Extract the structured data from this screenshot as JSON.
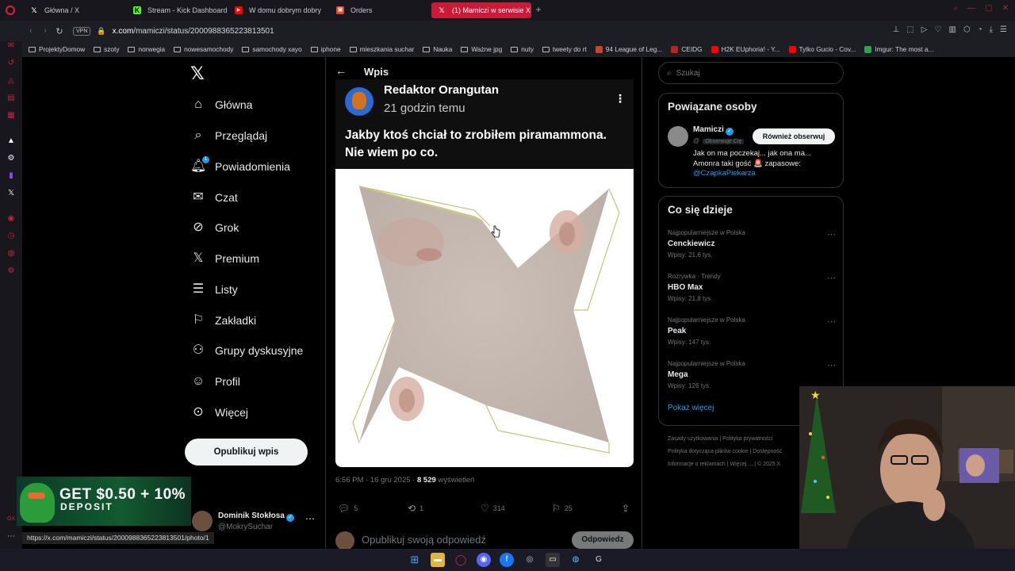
{
  "tabs": [
    {
      "title": "Główna / X",
      "favicon": "x-icon"
    },
    {
      "title": "Stream - Kick Dashboard",
      "favicon": "kick-icon"
    },
    {
      "title": "W domu dobrym dobry s",
      "favicon": "youtube-icon"
    },
    {
      "title": "Orders",
      "favicon": "orders-icon"
    },
    {
      "title": "(1) Mamiczi w serwisie X:",
      "favicon": "x-icon",
      "active": true
    }
  ],
  "address": {
    "vpn": "VPN",
    "host": "x.com",
    "path": "/mamiczi/status/2000988365223813501"
  },
  "bookmarks": [
    "ProjektyDomow",
    "szoty",
    "norwegia",
    "nowesamochody",
    "samochody xayo",
    "iphone",
    "mieszkania suchar",
    "Nauka",
    "Ważne jpg",
    "nuty",
    "tweety do rt",
    "94 League of Leg...",
    "CEIDG",
    "H2K EUphoria! - Y...",
    "Tylko Gucio - Cov...",
    "Imgur: The most a..."
  ],
  "nav": [
    {
      "label": "Główna",
      "icon": "home-icon"
    },
    {
      "label": "Przeglądaj",
      "icon": "search-icon"
    },
    {
      "label": "Powiadomienia",
      "icon": "bell-icon",
      "badge": "1"
    },
    {
      "label": "Czat",
      "icon": "mail-icon"
    },
    {
      "label": "Grok",
      "icon": "grok-icon"
    },
    {
      "label": "Premium",
      "icon": "x-premium-icon"
    },
    {
      "label": "Listy",
      "icon": "list-icon"
    },
    {
      "label": "Zakładki",
      "icon": "bookmark-icon"
    },
    {
      "label": "Grupy dyskusyjne",
      "icon": "people-icon"
    },
    {
      "label": "Profil",
      "icon": "person-icon"
    },
    {
      "label": "Więcej",
      "icon": "more-circle-icon"
    }
  ],
  "post_button": "Opublikuj wpis",
  "ad": {
    "line1": "GET $0.50 + 10%",
    "line2": "DEPOSIT"
  },
  "account": {
    "name": "Dominik Stokłosa",
    "handle": "@MokrySuchar"
  },
  "status_url": "https://x.com/mamiczi/status/2000988365223813501/photo/1",
  "center": {
    "title": "Wpis",
    "tweet": {
      "author": "Redaktor Orangutan",
      "time": "21 godzin temu",
      "text": "Jakby ktoś chciał to zrobiłem piramammona. Nie wiem po co.",
      "meta_time": "6:56 PM · 16 gru 2025 · ",
      "views": "8 529",
      "views_label": " wyświetleń",
      "replies": "5",
      "reposts": "1",
      "likes": "314",
      "bookmarks": "25"
    },
    "reply_placeholder": "Opublikuj swoją odpowiedź",
    "reply_button": "Odpowiedz"
  },
  "search": {
    "placeholder": "Szukaj"
  },
  "related": {
    "title": "Powiązane osoby",
    "name": "Mamiczi",
    "handle": "@",
    "follows_you": "Obserwuje Cię",
    "follow_button": "Również obserwuj",
    "bio": "Jak on ma poczekaj... jak ona ma... Amonra taki gość 🚨 zapasowe: ",
    "bio_link": "@CzapkaPiekarza"
  },
  "trends": {
    "title": "Co się dzieje",
    "items": [
      {
        "category": "Najpopularniejsze w Polska",
        "name": "Cenckiewicz",
        "count": "Wpisy: 21,6 tys."
      },
      {
        "category": "Rozrywka · Trendy",
        "name": "HBO Max",
        "count": "Wpisy: 21,8 tys."
      },
      {
        "category": "Najpopularniejsze w Polska",
        "name": "Peak",
        "count": "Wpisy: 147 tys."
      },
      {
        "category": "Najpopularniejsze w Polska",
        "name": "Mega",
        "count": "Wpisy: 126 tys."
      }
    ],
    "show_more": "Pokaż więcej"
  },
  "footer": {
    "links": [
      "Zasady użytkowania",
      "Polityka prywatności",
      "Polityka dotycząca plików cookie",
      "Dostępność",
      "Informacje o reklamach",
      "Więcej ...",
      "© 2025 X"
    ]
  },
  "colors": {
    "accent": "#1d9bf0",
    "opera_red": "#cc1a36",
    "background": "#000000"
  }
}
